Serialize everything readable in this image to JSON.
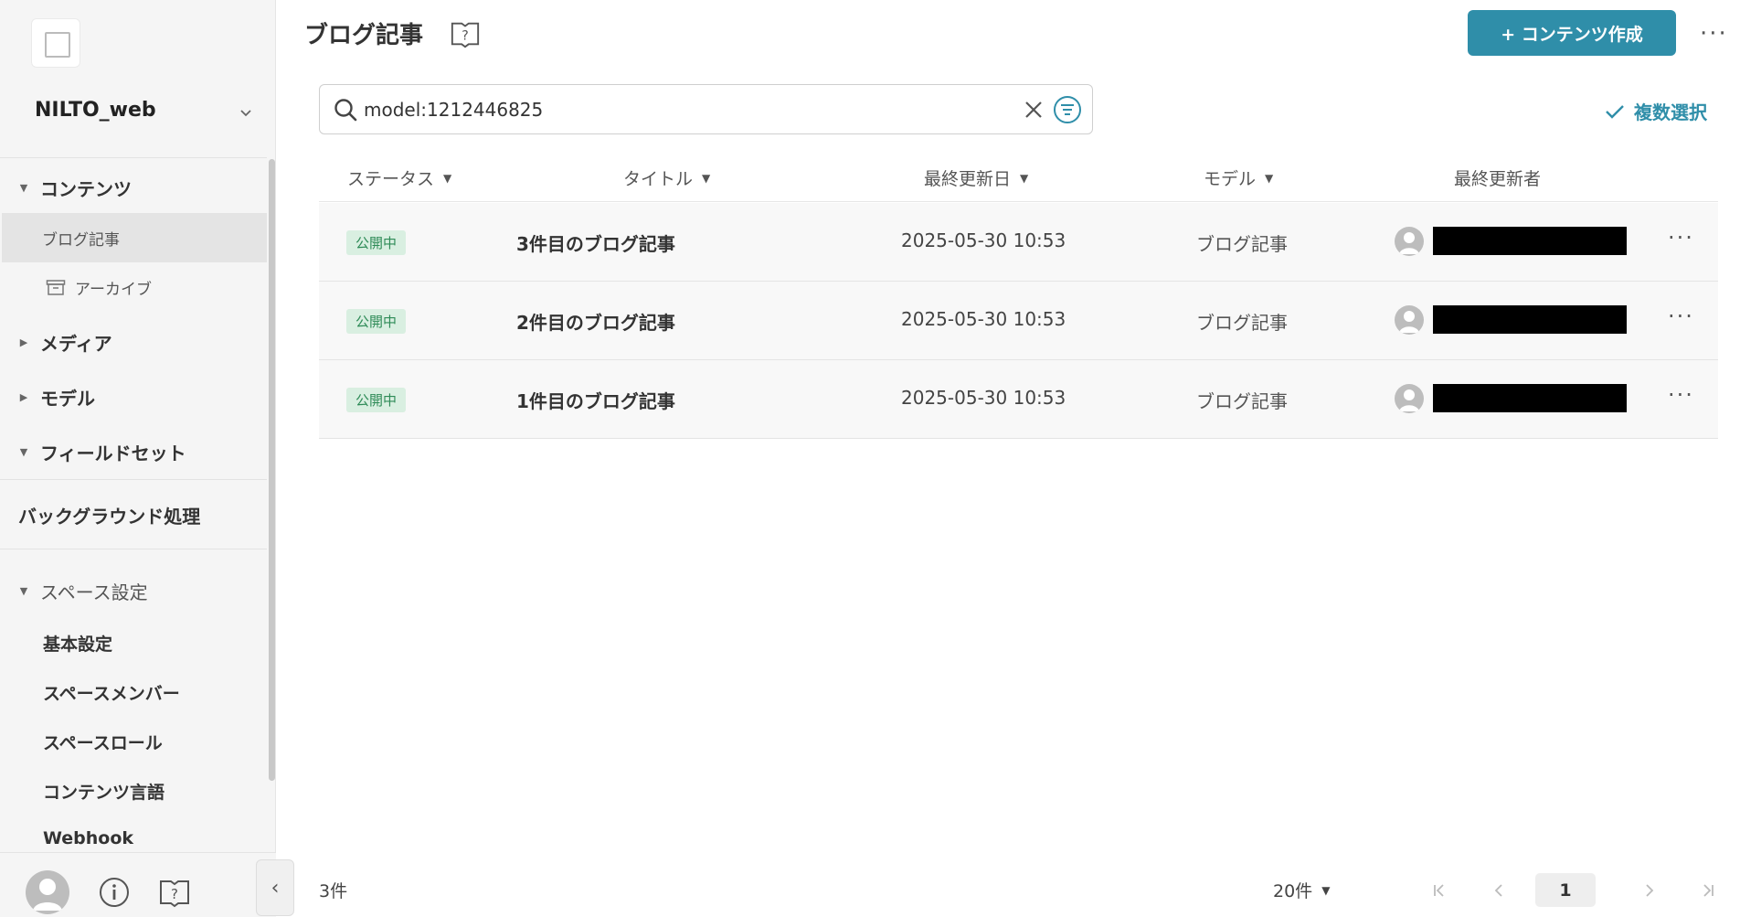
{
  "sidebar": {
    "space_name": "NILTO_web",
    "sections": {
      "contents": "コンテンツ",
      "media": "メディア",
      "model": "モデル",
      "fieldset": "フィールドセット",
      "background": "バックグラウンド処理",
      "space_settings": "スペース設定"
    },
    "sub_items": {
      "blog": "ブログ記事",
      "archive": "アーカイブ"
    },
    "settings_items": [
      "基本設定",
      "スペースメンバー",
      "スペースロール",
      "コンテンツ言語",
      "Webhook"
    ]
  },
  "header": {
    "title": "ブログ記事",
    "create_label": "+ コンテンツ作成"
  },
  "search": {
    "value": "model:1212446825"
  },
  "multi_select_label": "複数選択",
  "table": {
    "columns": [
      "ステータス",
      "タイトル",
      "最終更新日",
      "モデル",
      "最終更新者"
    ],
    "rows": [
      {
        "status": "公開中",
        "title": "3件目のブログ記事",
        "date": "2025-05-30 10:53",
        "model": "ブログ記事"
      },
      {
        "status": "公開中",
        "title": "2件目のブログ記事",
        "date": "2025-05-30 10:53",
        "model": "ブログ記事"
      },
      {
        "status": "公開中",
        "title": "1件目のブログ記事",
        "date": "2025-05-30 10:53",
        "model": "ブログ記事"
      }
    ]
  },
  "footer": {
    "count": "3件",
    "per_page": "20件",
    "current_page": "1"
  },
  "colors": {
    "accent": "#2f8ea9",
    "badge_bg": "#d9efe1",
    "badge_text": "#2e8b57"
  }
}
